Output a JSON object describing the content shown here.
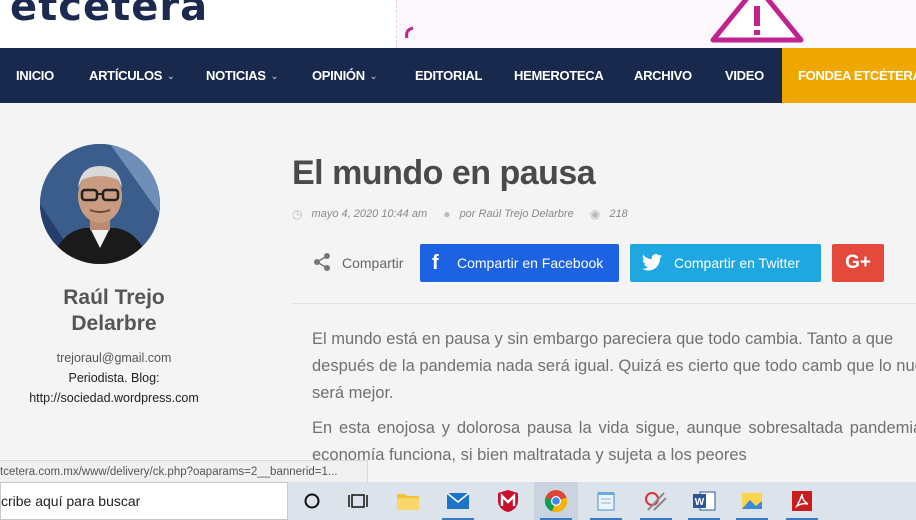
{
  "brand": {
    "logo_text": "etcetera"
  },
  "nav": {
    "items": [
      {
        "label": "INICIO",
        "dropdown": false
      },
      {
        "label": "ARTÍCULOS",
        "dropdown": true
      },
      {
        "label": "NOTICIAS",
        "dropdown": true
      },
      {
        "label": "OPINIÓN",
        "dropdown": true
      },
      {
        "label": "EDITORIAL",
        "dropdown": false
      },
      {
        "label": "HEMEROTECA",
        "dropdown": false
      },
      {
        "label": "ARCHIVO",
        "dropdown": false
      },
      {
        "label": "VIDEO",
        "dropdown": false
      }
    ],
    "cta_label": "FONDEA ETCÉTERA"
  },
  "author": {
    "name": "Raúl Trejo Delarbre",
    "email": "trejoraul@gmail.com",
    "bio_line1": "Periodista. Blog:",
    "bio_line2": "http://sociedad.wordpress.com"
  },
  "article": {
    "title": "El mundo en pausa",
    "date": "mayo 4, 2020 10:44 am",
    "author_byline": "por Raúl Trejo Delarbre",
    "views": "218",
    "paragraphs": [
      "El mundo está en pausa y sin embargo pareciera que todo cambia. Tanto a que después de la pandemia nada será igual. Quizá es cierto que todo camb que lo nuevo será mejor.",
      "En esta enojosa y dolorosa pausa la vida sigue, aunque sobresaltada pandemia. La economía funciona, si bien maltratada y sujeta a los peores"
    ]
  },
  "share": {
    "label": "Compartir",
    "facebook_label": "Compartir en Facebook",
    "twitter_label": "Compartir en Twitter",
    "gplus_label": "G+"
  },
  "status_url": "tcetera.com.mx/www/delivery/ck.php?oaparams=2__bannerid=1...",
  "taskbar": {
    "search_text": "cribe aquí para buscar",
    "icons": [
      "cortana-icon",
      "task-view-icon",
      "file-explorer-icon",
      "mail-icon",
      "mcafee-icon",
      "chrome-icon",
      "notepad-icon",
      "snipping-icon",
      "word-icon",
      "photos-icon",
      "acrobat-icon"
    ]
  },
  "colors": {
    "nav_bg": "#18294d",
    "cta_bg": "#f0a800",
    "facebook": "#1c62e3",
    "twitter": "#1ea7e1",
    "gplus": "#e44a3c",
    "ad_accent": "#c0238d"
  }
}
